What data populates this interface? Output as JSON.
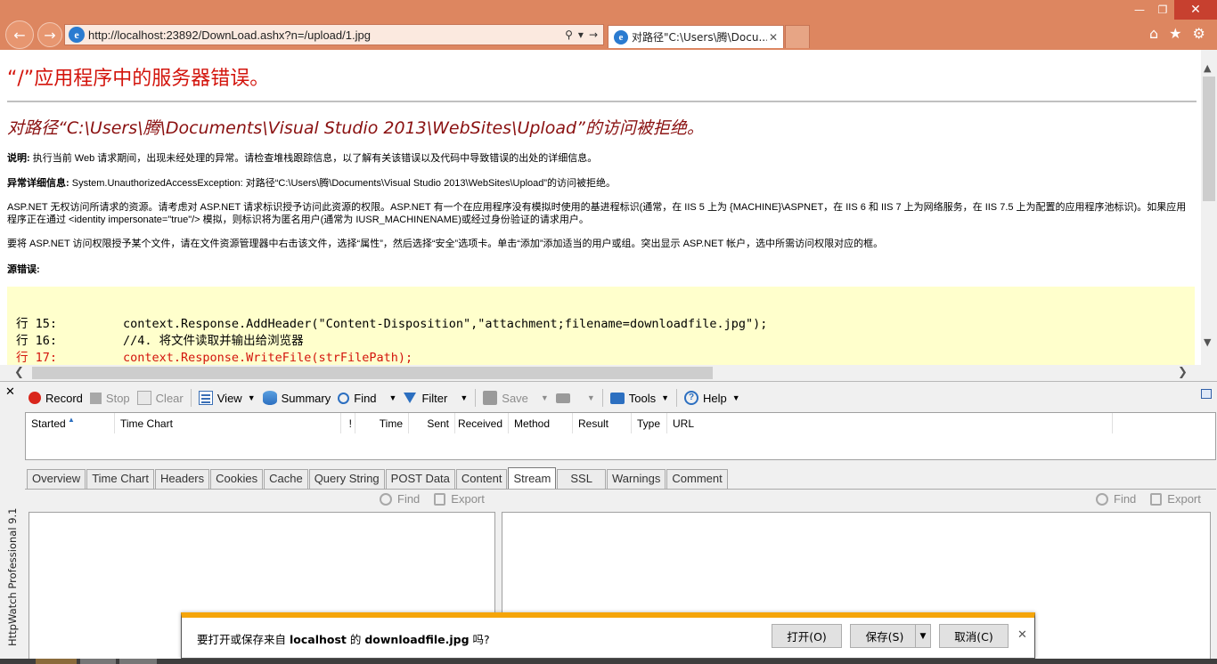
{
  "browser": {
    "url": "http://localhost:23892/DownLoad.ashx?n=/upload/1.jpg",
    "tab_title": "对路径\"C:\\Users\\腾\\Docu...",
    "tab_close": "✕",
    "back_icon": "back-arrow-icon",
    "forward_icon": "forward-arrow-icon",
    "window_controls": {
      "minimize": "—",
      "maximize": "❐",
      "close": "✕"
    },
    "command_icons": {
      "home": "⌂",
      "favorites": "★",
      "tools": "⚙"
    }
  },
  "error_page": {
    "title": "“/”应用程序中的服务器错误。",
    "subtitle": "对路径“C:\\Users\\腾\\Documents\\Visual Studio 2013\\WebSites\\Upload”的访问被拒绝。",
    "desc_label": "说明:",
    "desc_text": " 执行当前 Web 请求期间，出现未经处理的异常。请检查堆栈跟踪信息，以了解有关该错误以及代码中导致错误的出处的详细信息。",
    "exception_label": "异常详细信息:",
    "exception_text": " System.UnauthorizedAccessException: 对路径“C:\\Users\\腾\\Documents\\Visual Studio 2013\\WebSites\\Upload”的访问被拒绝。",
    "para1": "ASP.NET 无权访问所请求的资源。请考虑对 ASP.NET 请求标识授予访问此资源的权限。ASP.NET 有一个在应用程序没有模拟时使用的基进程标识(通常，在 IIS 5 上为 {MACHINE}\\ASPNET，在 IIS 6 和 IIS 7 上为网络服务，在 IIS 7.5 上为配置的应用程序池标识)。如果应用程序正在通过 <identity impersonate=\"true\"/> 模拟，则标识将为匿名用户(通常为 IUSR_MACHINENAME)或经过身份验证的请求用户。",
    "para2": "要将 ASP.NET 访问权限授予某个文件，请在文件资源管理器中右击该文件，选择“属性”，然后选择“安全”选项卡。单击“添加”添加适当的用户或组。突出显示 ASP.NET 帐户，选中所需访问权限对应的框。",
    "source_label": "源错误:",
    "code_lines": [
      {
        "ln": "行 15:",
        "code": "context.Response.AddHeader(\"Content-Disposition\",\"attachment;filename=downloadfile.jpg\");"
      },
      {
        "ln": "行 16:",
        "code": "//4. 将文件读取并输出给浏览器"
      },
      {
        "ln": "行 17:",
        "code": "context.Response.WriteFile(strFilePath);"
      }
    ]
  },
  "httpwatch": {
    "side_label": "HttpWatch Professional 9.1",
    "close": "✕",
    "toolbar": {
      "record": "Record",
      "stop": "Stop",
      "clear": "Clear",
      "view": "View",
      "summary": "Summary",
      "find": "Find",
      "filter": "Filter",
      "save": "Save",
      "tools": "Tools",
      "help": "Help",
      "help_glyph": "?"
    },
    "columns": [
      "Started",
      "Time Chart",
      "!",
      "Time",
      "Sent",
      "Received",
      "Method",
      "Result",
      "Type",
      "URL"
    ],
    "tabs": [
      "Overview",
      "Time Chart",
      "Headers",
      "Cookies",
      "Cache",
      "Query String",
      "POST Data",
      "Content",
      "Stream",
      "SSL",
      "Warnings",
      "Comment"
    ],
    "active_tab": "Stream",
    "panel_tools": {
      "find": "Find",
      "export": "Export"
    }
  },
  "download_bar": {
    "msg_prefix": "要打开或保存来自 ",
    "host": "localhost",
    "msg_mid": " 的 ",
    "file": "downloadfile.jpg",
    "msg_suffix": " 吗?",
    "open": "打开(O)",
    "save": "保存(S)",
    "cancel": "取消(C)",
    "close": "✕"
  }
}
